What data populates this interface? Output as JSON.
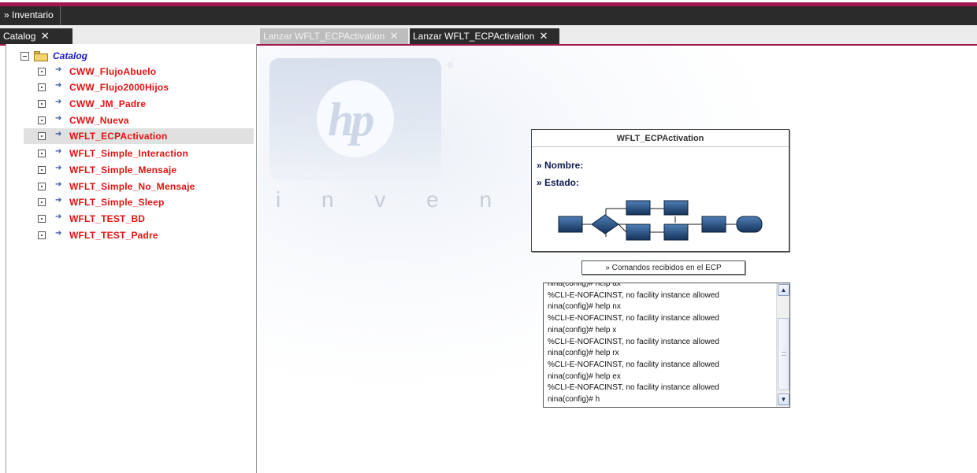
{
  "menubar": {
    "items": [
      {
        "label": "» Inventario"
      }
    ]
  },
  "panel_tabs": {
    "catalog": {
      "label": "Catalog",
      "close": "✕"
    }
  },
  "content_tabs": [
    {
      "label": "Lanzar WFLT_ECPActivation",
      "close": "✕",
      "active": false
    },
    {
      "label": "Lanzar WFLT_ECPActivation",
      "close": "✕",
      "active": true
    }
  ],
  "tree": {
    "root": {
      "label": "Catalog",
      "icon": "folder-icon",
      "expander": "minus"
    },
    "items": [
      {
        "label": "CWW_FlujoAbuelo"
      },
      {
        "label": "CWW_Flujo2000Hijos"
      },
      {
        "label": "CWW_JM_Padre"
      },
      {
        "label": "CWW_Nueva"
      },
      {
        "label": "WFLT_ECPActivation",
        "selected": true
      },
      {
        "label": "WFLT_Simple_Interaction"
      },
      {
        "label": "WFLT_Simple_Mensaje"
      },
      {
        "label": "WFLT_Simple_No_Mensaje"
      },
      {
        "label": "WFLT_Simple_Sleep"
      },
      {
        "label": "WFLT_TEST_BD"
      },
      {
        "label": "WFLT_TEST_Padre"
      }
    ]
  },
  "watermark": {
    "brand": "hp",
    "registered": "®",
    "tagline": "i n v e n t"
  },
  "workflow_card": {
    "title": "WFLT_ECPActivation",
    "nombre_label": "» Nombre:",
    "estado_label": "» Estado:"
  },
  "commands_button": {
    "label": "» Comandos recibidos en el ECP"
  },
  "console": {
    "lines": [
      "nina(config)# help ax",
      "%CLI-E-NOFACINST, no facility instance allowed",
      "nina(config)# help nx",
      "%CLI-E-NOFACINST, no facility instance allowed",
      "nina(config)# help  x",
      "%CLI-E-NOFACINST, no facility instance allowed",
      "nina(config)# help rx",
      "%CLI-E-NOFACINST, no facility instance allowed",
      "nina(config)# help ex",
      "%CLI-E-NOFACINST, no facility instance allowed",
      "nina(config)# h"
    ],
    "scroll_up": "▲",
    "scroll_down": "▼"
  },
  "colors": {
    "accent": "#a3174f",
    "dark_bar": "#2b2b2b",
    "tree_item": "#e51111",
    "tree_root": "#1a1ac9",
    "selected_row": "#e0e0e0"
  }
}
